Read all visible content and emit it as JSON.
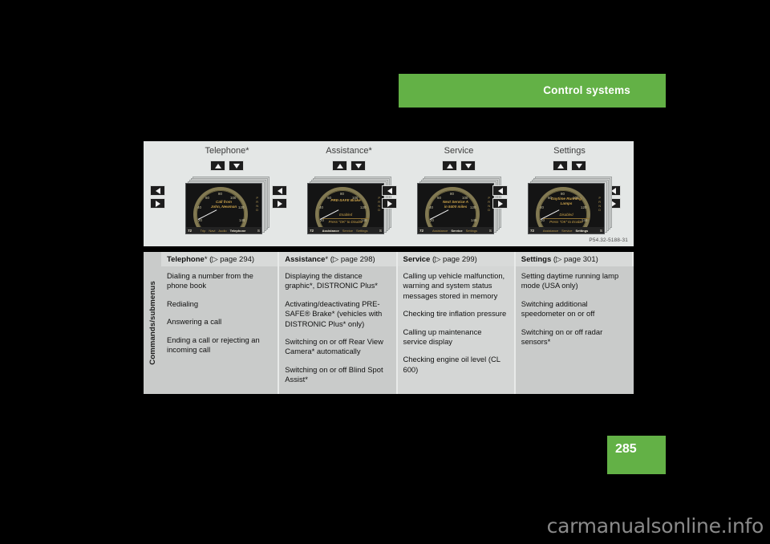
{
  "header": {
    "title": "Control systems",
    "accent_color": "#63b146"
  },
  "page": {
    "number": "285"
  },
  "watermark": {
    "text": "carmanualsonline.info"
  },
  "figure": {
    "caption": "P54.32-5188-31",
    "background_color": "#e4e7e6",
    "clusters": [
      {
        "title": "Telephone*",
        "message": "Call from",
        "message2": "John, Newman",
        "sub": "",
        "sub2": "",
        "speed": "72",
        "menu": [
          "Trip",
          "Navi",
          "Audio",
          "Telephone"
        ],
        "active_menu": "Telephone",
        "right_value": "S"
      },
      {
        "title": "Assistance*",
        "message": "PRE-SAFE Brake",
        "message2": "",
        "sub": "Enabled",
        "sub2": "Press \"OK\" to Disable",
        "speed": "72",
        "menu": [
          "Assistance",
          "Service",
          "Settings"
        ],
        "active_menu": "Assistance",
        "right_value": "S"
      },
      {
        "title": "Service",
        "message": "Next Service A",
        "message2": "in 5400 miles",
        "sub": "",
        "sub2": "",
        "speed": "72",
        "menu": [
          "Assistance",
          "Service",
          "Settings"
        ],
        "active_menu": "Service",
        "right_value": "S"
      },
      {
        "title": "Settings",
        "message": "Daytime Running",
        "message2": "Lamps",
        "sub": "Disabled",
        "sub2": "Press \"OK\" to Enable",
        "speed": "72",
        "menu": [
          "Assistance",
          "Service",
          "Settings"
        ],
        "active_menu": "Settings",
        "right_value": "S"
      }
    ],
    "gauge_ticks": [
      "20",
      "40",
      "60",
      "80",
      "100",
      "120",
      "140",
      "160"
    ],
    "side_icons": [
      "!",
      "·",
      "P",
      "R",
      "N",
      "D"
    ]
  },
  "table": {
    "row_label": "Commands/submenus",
    "columns": [
      {
        "name": "Telephone",
        "star": "*",
        "page_ref": "(▷ page 294)",
        "items": [
          "Dialing a number from the phone book",
          "Redialing",
          "Answering a call",
          "Ending a call or rejecting an incoming call"
        ]
      },
      {
        "name": "Assistance",
        "star": "*",
        "page_ref": "(▷ page 298)",
        "items": [
          "Displaying the distance graphic*, DISTRONIC Plus*",
          "Activating/deactivating PRE-SAFE® Brake* (vehicles with DISTRONIC Plus* only)",
          "Switching on or off Rear View Camera* automatically",
          "Switching on or off Blind Spot Assist*"
        ]
      },
      {
        "name": "Service",
        "star": "",
        "page_ref": "(▷ page 299)",
        "items": [
          "Calling up vehicle malfunction, warning and system status messages stored in memory",
          "Checking tire inflation pressure",
          "Calling up maintenance service display",
          "Checking engine oil level (CL 600)"
        ]
      },
      {
        "name": "Settings",
        "star": "",
        "page_ref": "(▷ page 301)",
        "items": [
          "Setting daytime running lamp mode (USA only)",
          "Switching additional speedometer on or off",
          "Switching on or off radar sensors*",
          ""
        ]
      }
    ]
  }
}
